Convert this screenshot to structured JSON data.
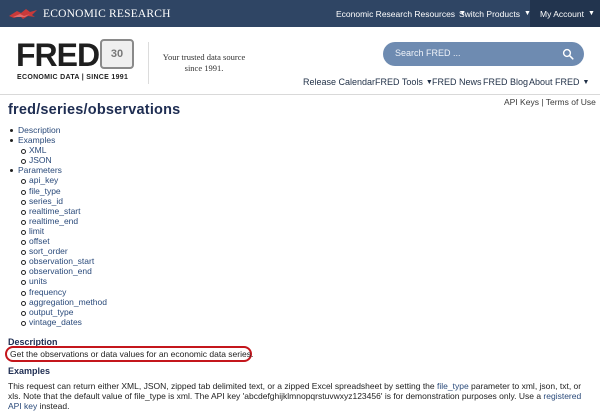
{
  "topbar": {
    "brand": "ECONOMIC RESEARCH",
    "resources": "Economic Research Resources",
    "switch": "Switch Products",
    "account": "My Account"
  },
  "header": {
    "logo_word": "FRED",
    "logo_badge": "30",
    "logo_sub": "ECONOMIC DATA  |  SINCE 1991",
    "tagline_1": "Your trusted data source",
    "tagline_2": "since 1991.",
    "search_placeholder": "Search FRED ...",
    "nav": {
      "release_calendar": "Release Calendar",
      "tools": "FRED Tools",
      "news": "FRED News",
      "blog": "FRED Blog",
      "about": "About FRED"
    }
  },
  "page": {
    "api_keys": "API Keys",
    "sep": " | ",
    "terms": "Terms of Use",
    "title": "fred/series/observations",
    "toc": {
      "description": "Description",
      "examples": "Examples",
      "examples_items": [
        "XML",
        "JSON"
      ],
      "parameters": "Parameters",
      "parameter_items": [
        "api_key",
        "file_type",
        "series_id",
        "realtime_start",
        "realtime_end",
        "limit",
        "offset",
        "sort_order",
        "observation_start",
        "observation_end",
        "units",
        "frequency",
        "aggregation_method",
        "output_type",
        "vintage_dates"
      ]
    },
    "description_heading": "Description",
    "description_text": "Get the observations or data values for an economic data series.",
    "examples_heading": "Examples",
    "examples_text_1": "This request can return either XML, JSON, zipped tab delimited text, or a zipped Excel spreadsheet by setting the ",
    "examples_link_file_type": "file_type",
    "examples_text_2": " parameter to xml, json, txt, or xls. Note that the default value of file_type is xml. The API key 'abcdefghijklmnopqrstuvwxyz123456' is for demonstration purposes only. Use a ",
    "examples_link_registered": "registered API key",
    "examples_text_3": " instead."
  },
  "colors": {
    "topbar_bg": "#2f4564",
    "search_bg": "#6e8bb1",
    "title": "#1e2d52",
    "highlight": "#c4161c"
  }
}
